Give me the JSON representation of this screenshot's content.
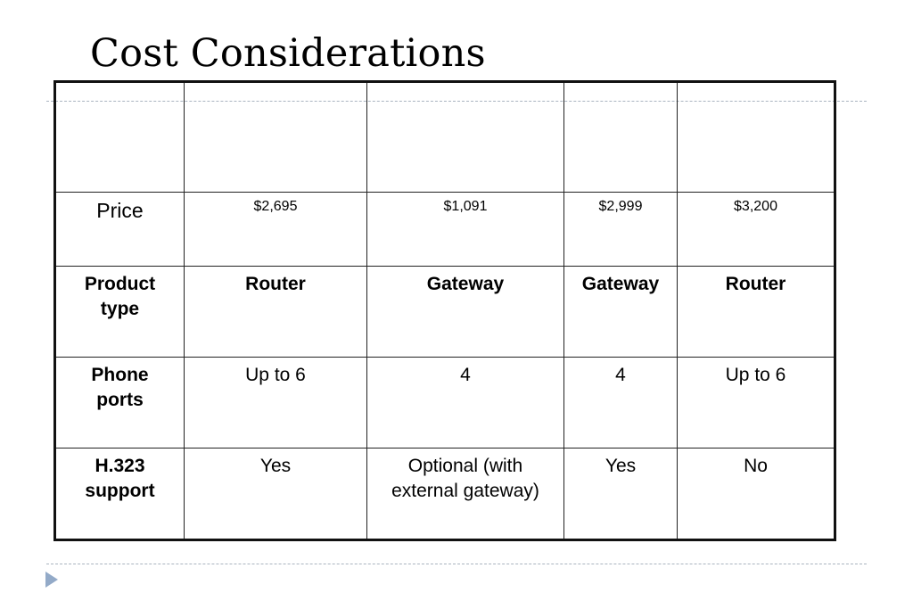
{
  "slide": {
    "title": "Cost Considerations"
  },
  "table": {
    "header_row": [
      "",
      "",
      "",
      "",
      ""
    ],
    "rows": [
      {
        "label": "Price",
        "values": [
          "$2,695",
          "$1,091",
          "$2,999",
          "$3,200"
        ]
      },
      {
        "label": "Product type",
        "values": [
          "Router",
          "Gateway",
          "Gateway",
          "Router"
        ]
      },
      {
        "label": "Phone ports",
        "values": [
          "Up to 6",
          "4",
          "4",
          "Up to 6"
        ]
      },
      {
        "label": "H.323 support",
        "values": [
          "Yes",
          "Optional (with external gateway)",
          "Yes",
          "No"
        ]
      }
    ]
  },
  "decor": {
    "bullet_icon": "triangle-right-icon",
    "accent_color": "#93aac8",
    "guide_color": "#aab4c0"
  }
}
